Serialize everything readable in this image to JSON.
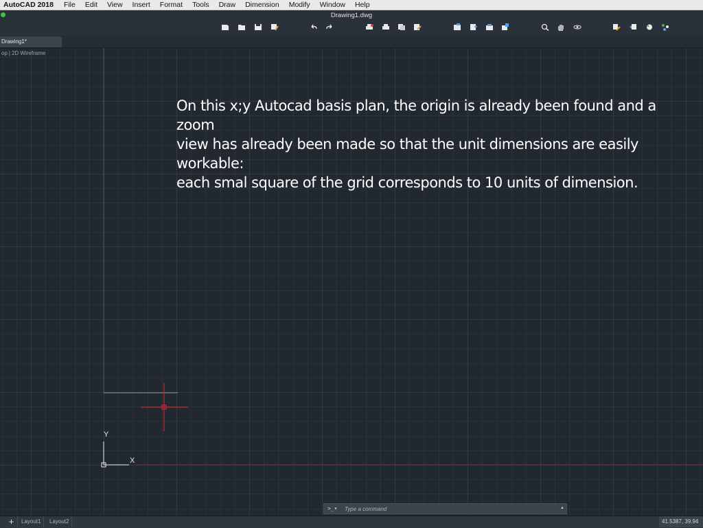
{
  "menubar": {
    "app_name": "AutoCAD 2018",
    "items": [
      "File",
      "Edit",
      "View",
      "Insert",
      "Format",
      "Tools",
      "Draw",
      "Dimension",
      "Modify",
      "Window",
      "Help"
    ]
  },
  "window": {
    "title": "Drawing1.dwg"
  },
  "toolbar": {
    "icons": [
      "new-icon",
      "open-icon",
      "save-icon",
      "save-as-icon",
      "undo-icon",
      "redo-icon",
      "plot-icon",
      "plot-preview-icon",
      "publish-icon",
      "page-setup-icon",
      "properties-icon",
      "layers-icon",
      "sheet-set-icon",
      "tool-palettes-icon",
      "zoom-icon",
      "pan-icon",
      "orbit-icon",
      "match-properties-icon",
      "block-editor-icon",
      "render-icon",
      "object-snap-icon"
    ]
  },
  "tabs": {
    "document": "Drawing1*"
  },
  "viewport": {
    "view": "op",
    "visual_style": "2D Wireframe"
  },
  "ucs": {
    "x_label": "X",
    "y_label": "Y"
  },
  "annotation": {
    "text": "On this x;y Autocad basis plan, the origin is already been found and a zoom\nview has already been made so that the unit dimensions are easily workable:\neach smal square of the grid corresponds to 10 units of dimension."
  },
  "command": {
    "prompt": ">_▾",
    "placeholder": "Type a command"
  },
  "status": {
    "add_label": "+",
    "layouts": [
      "Layout1",
      "Layout2"
    ],
    "coordinates": "41.5387, 39.94"
  },
  "colors": {
    "background": "#212830",
    "grid_minor": "#2a323b",
    "grid_major": "#323b45",
    "x_axis": "#7a2a33",
    "y_axis": "#2f6b3a",
    "cursor": "#c8282c"
  }
}
